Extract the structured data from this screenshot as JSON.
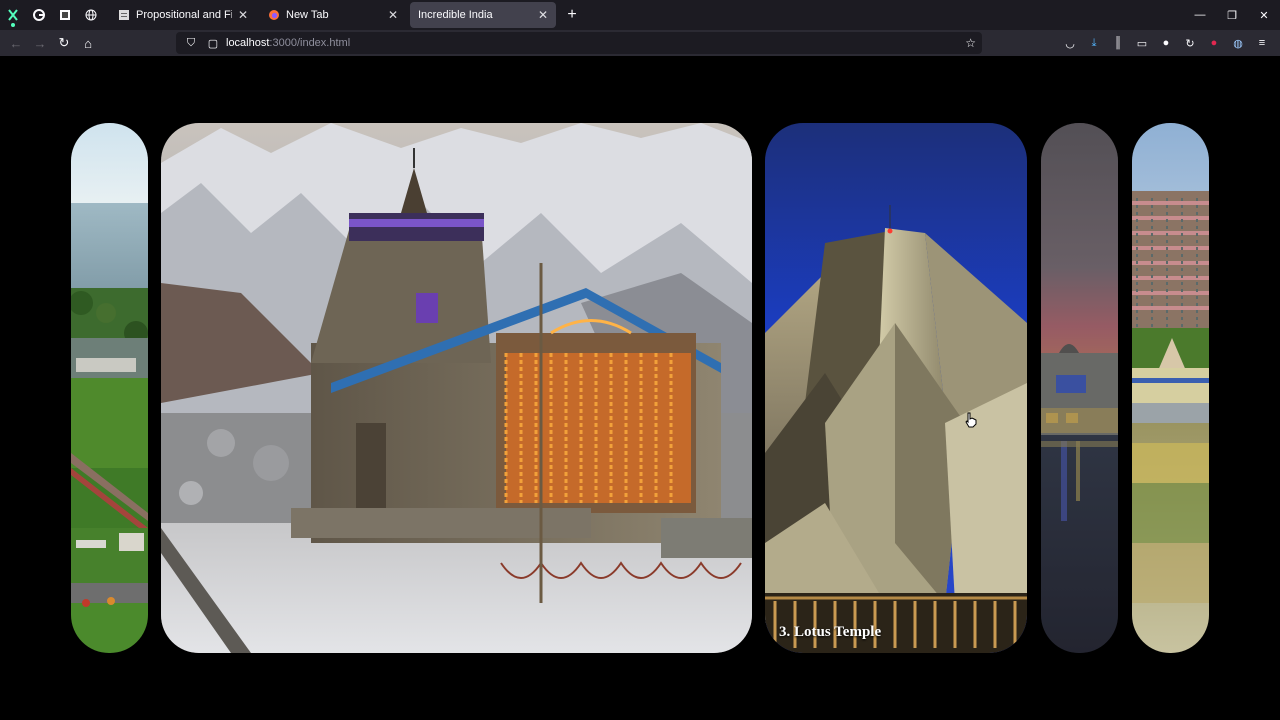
{
  "browser": {
    "tabs": [
      {
        "title": "Propositional and First Order Lo"
      },
      {
        "title": "New Tab"
      },
      {
        "title": "Incredible India"
      }
    ],
    "address": {
      "host": "localhost",
      "path": ":3000/index.html"
    }
  },
  "slider": {
    "cards": [
      {
        "caption": ""
      },
      {
        "caption": ""
      },
      {
        "caption": "3. Lotus Temple"
      },
      {
        "caption": ""
      },
      {
        "caption": ""
      }
    ]
  }
}
